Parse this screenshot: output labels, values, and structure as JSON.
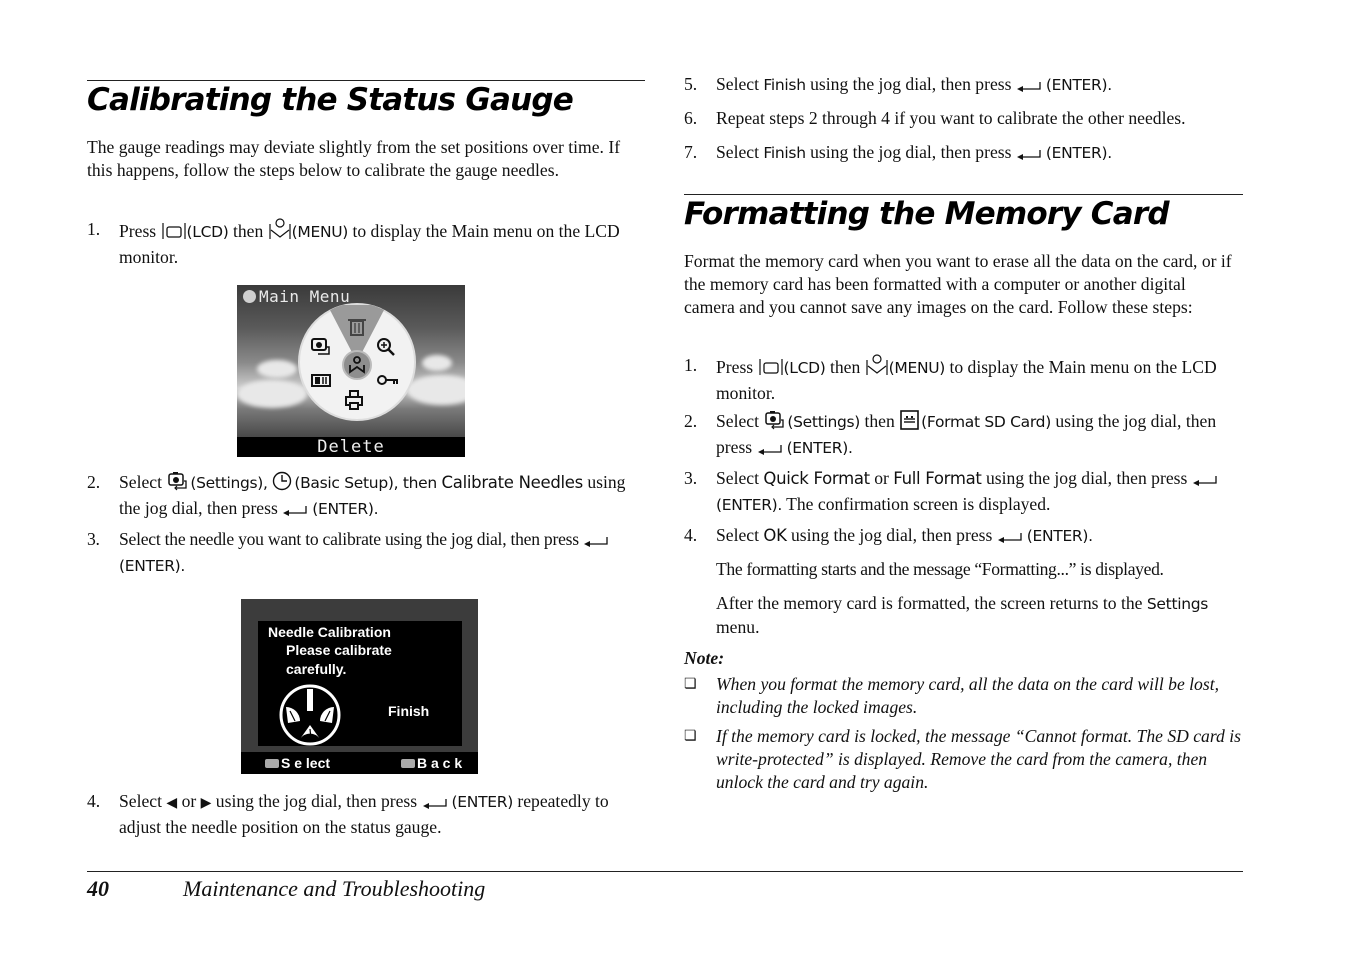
{
  "left": {
    "heading": "Calibrating the Status Gauge",
    "intro": "The gauge readings may deviate slightly from the set positions over time. If this happens, follow the steps below to calibrate the gauge needles.",
    "steps": [
      {
        "num": "1.",
        "parts": [
          "Press ",
          "(LCD)",
          " then ",
          "(MENU)",
          " to display the Main menu on the LCD monitor."
        ]
      },
      {
        "num": "2.",
        "parts": [
          "Select ",
          "(Settings), ",
          "(Basic Setup), then ",
          "Calibrate Needles",
          " using the jog dial, then press ",
          "(ENTER)."
        ]
      },
      {
        "num": "3.",
        "parts": [
          "Select the needle you want to calibrate using the jog dial, then press ",
          "(ENTER)."
        ]
      },
      {
        "num": "4.",
        "parts": [
          "Select ",
          " or ",
          " using the jog dial, then press ",
          "(ENTER)",
          " repeatedly to adjust the needle position on the status gauge."
        ]
      }
    ],
    "lcd_main_menu": {
      "title": "Main Menu",
      "selected_label": "Delete",
      "icons": [
        "trash-icon",
        "zoom-icon",
        "key-icon",
        "print-icon",
        "album-icon",
        "settings-camera-icon",
        "menu-center-icon"
      ]
    },
    "lcd_needle": {
      "title": "Needle Calibration",
      "line2": "Please calibrate",
      "line3": "carefully.",
      "option": "Finish",
      "select_label": "S e lect",
      "back_label": "B a c k"
    }
  },
  "right": {
    "steps_top": [
      {
        "num": "5.",
        "parts": [
          "Select ",
          "Finish",
          " using the jog dial, then press ",
          "(ENTER)."
        ]
      },
      {
        "num": "6.",
        "parts": [
          "Repeat steps 2 through 4 if you want to calibrate the other needles."
        ]
      },
      {
        "num": "7.",
        "parts": [
          "Select ",
          "Finish",
          " using the jog dial, then press ",
          "(ENTER)."
        ]
      }
    ],
    "heading": "Formatting the Memory Card",
    "intro": "Format the memory card when you want to erase all the data on the card, or if the memory card has been formatted with a computer or another digital camera and you cannot save any images on the card. Follow these steps:",
    "steps": [
      {
        "num": "1.",
        "parts": [
          "Press ",
          "(LCD)",
          " then ",
          "(MENU)",
          " to display the Main menu on the LCD monitor."
        ]
      },
      {
        "num": "2.",
        "parts": [
          "Select ",
          "(Settings)",
          " then ",
          "(Format SD Card)",
          " using the jog dial, then press ",
          "(ENTER)."
        ]
      },
      {
        "num": "3.",
        "parts": [
          "Select ",
          "Quick Format",
          " or ",
          "Full Format",
          " using the jog dial, then press ",
          "(ENTER).",
          " The confirmation screen is displayed."
        ]
      },
      {
        "num": "4.",
        "parts": [
          "Select ",
          "OK",
          " using the jog dial, then press ",
          "(ENTER)."
        ]
      }
    ],
    "step4_para1": "The formatting starts and the message “Formatting...” is displayed.",
    "step4_para2_a": "After the memory card is formatted, the screen returns to the ",
    "step4_para2_ui": "Settings",
    "step4_para2_b": " menu.",
    "note": {
      "title": "Note:",
      "items": [
        "When you format the memory card, all the data on the card will be lost, including the locked images.",
        "If the memory card is locked, the message “Cannot format. The SD card is write-protected” is displayed. Remove the card from the camera, then unlock the card and try again."
      ],
      "bullet": "❏"
    }
  },
  "footer": {
    "page_number": "40",
    "section_title": "Maintenance and Troubleshooting"
  }
}
